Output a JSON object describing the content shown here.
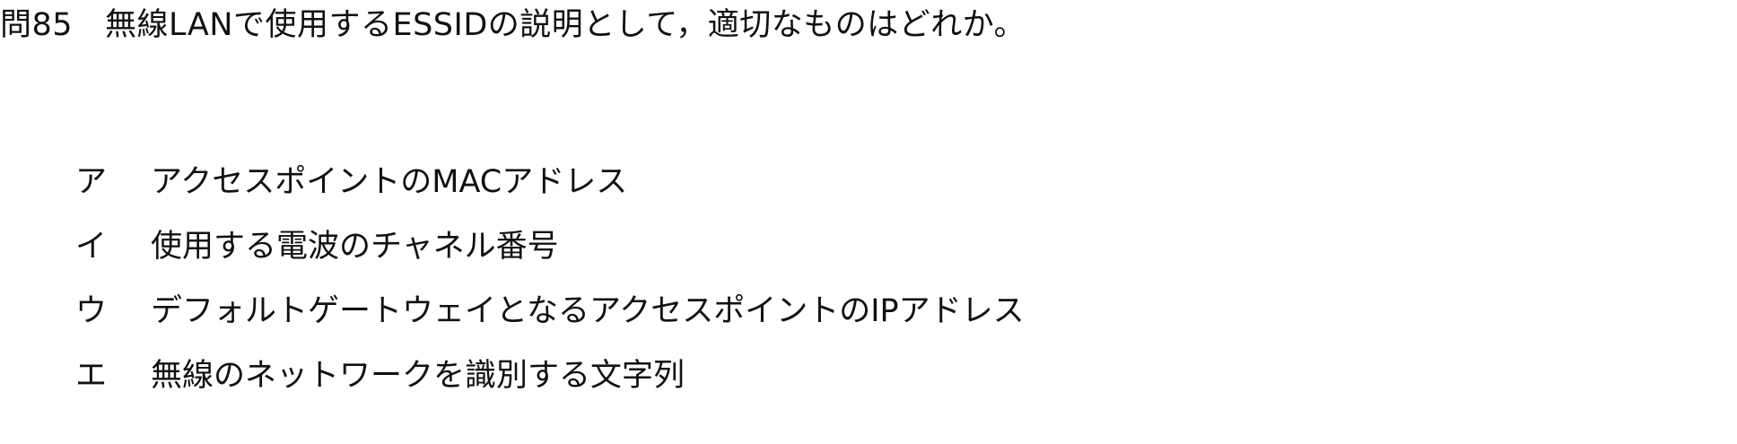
{
  "question": {
    "number": "問85",
    "text": "無線LANで使用するESSIDの説明として，適切なものはどれか。"
  },
  "choices": [
    {
      "mark": "ア",
      "text": "アクセスポイントのMACアドレス"
    },
    {
      "mark": "イ",
      "text": "使用する電波のチャネル番号"
    },
    {
      "mark": "ウ",
      "text": "デフォルトゲートウェイとなるアクセスポイントのIPアドレス"
    },
    {
      "mark": "エ",
      "text": "無線のネットワークを識別する文字列"
    }
  ]
}
